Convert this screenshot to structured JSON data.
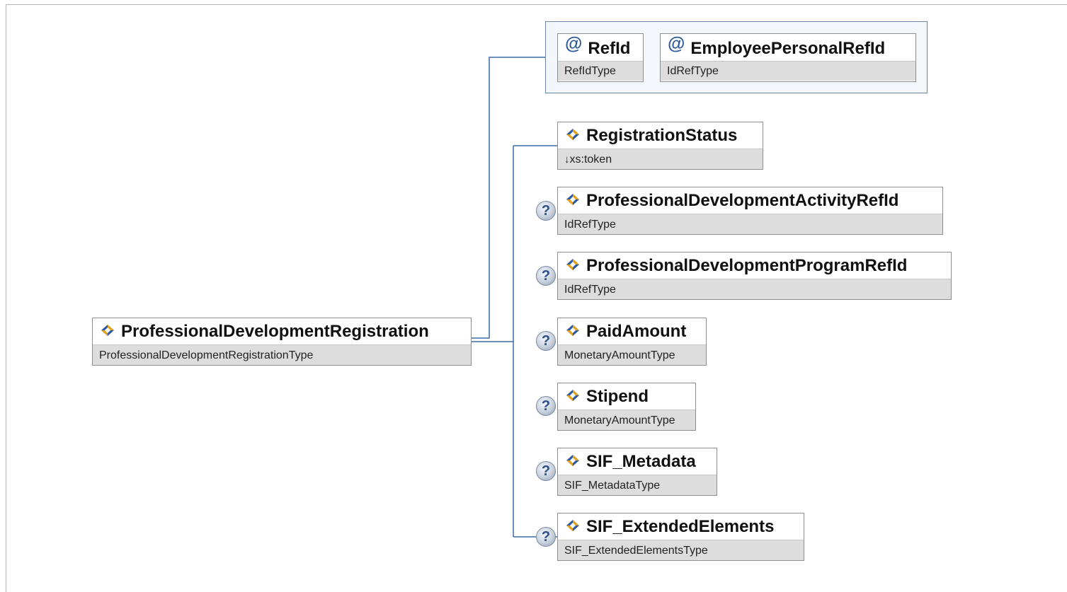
{
  "root": {
    "name": "ProfessionalDevelopmentRegistration",
    "type": "ProfessionalDevelopmentRegistrationType"
  },
  "attributes": [
    {
      "name": "RefId",
      "type": "RefIdType"
    },
    {
      "name": "EmployeePersonalRefId",
      "type": "IdRefType"
    }
  ],
  "elements": [
    {
      "name": "RegistrationStatus",
      "type_arrow": "↓",
      "type": "xs:token",
      "optional": false
    },
    {
      "name": "ProfessionalDevelopmentActivityRefId",
      "type": "IdRefType",
      "optional": true
    },
    {
      "name": "ProfessionalDevelopmentProgramRefId",
      "type": "IdRefType",
      "optional": true
    },
    {
      "name": "PaidAmount",
      "type": "MonetaryAmountType",
      "optional": true
    },
    {
      "name": "Stipend",
      "type": "MonetaryAmountType",
      "optional": true
    },
    {
      "name": "SIF_Metadata",
      "type": "SIF_MetadataType",
      "optional": true
    },
    {
      "name": "SIF_ExtendedElements",
      "type": "SIF_ExtendedElementsType",
      "optional": true
    }
  ],
  "icons": {
    "element": "element-diamond-icon",
    "attribute": "at-sign-icon",
    "optional": "question-mark-icon"
  },
  "colors": {
    "connector": "#3a6ea5",
    "icon_blue": "#2d5a9c",
    "icon_gold": "#e3a21a",
    "type_band": "#dddddd"
  }
}
